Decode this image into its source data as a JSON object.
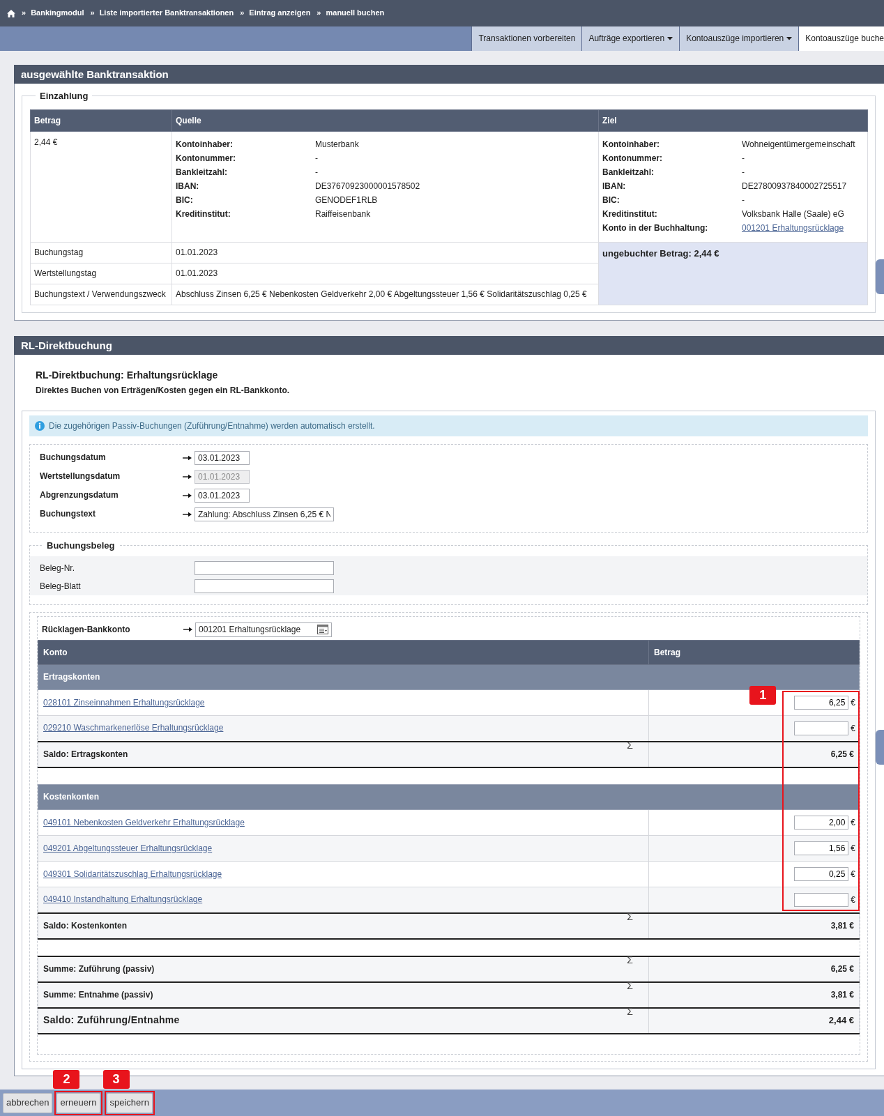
{
  "breadcrumb": {
    "separator": "»",
    "items": [
      "Bankingmodul",
      "Liste importierter Banktransaktionen",
      "Eintrag anzeigen",
      "manuell buchen"
    ]
  },
  "tabs": [
    {
      "label": "Transaktionen vorbereiten",
      "menu": false,
      "selected": false
    },
    {
      "label": "Aufträge exportieren",
      "menu": true,
      "selected": false
    },
    {
      "label": "Kontoauszüge importieren",
      "menu": true,
      "selected": false
    },
    {
      "label": "Kontoauszüge buche",
      "menu": false,
      "selected": true
    }
  ],
  "transaction_panel": {
    "title": "ausgewählte Banktransaktion",
    "legend": "Einzahlung",
    "columns": [
      "Betrag",
      "Quelle",
      "Ziel"
    ],
    "amount": "2,44 €",
    "source": [
      {
        "label": "Kontoinhaber:",
        "value": "Musterbank",
        "kind": "text"
      },
      {
        "label": "Kontonummer:",
        "value": "-",
        "kind": "text"
      },
      {
        "label": "Bankleitzahl:",
        "value": "-",
        "kind": "text"
      },
      {
        "label": "IBAN:",
        "value": "DE37670923000001578502",
        "kind": "text"
      },
      {
        "label": "BIC:",
        "value": "GENODEF1RLB",
        "kind": "text"
      },
      {
        "label": "Kreditinstitut:",
        "value": "Raiffeisenbank",
        "kind": "text"
      }
    ],
    "target": [
      {
        "label": "Kontoinhaber:",
        "value": "Wohneigentümergemeinschaft",
        "kind": "text"
      },
      {
        "label": "Kontonummer:",
        "value": "-",
        "kind": "text"
      },
      {
        "label": "Bankleitzahl:",
        "value": "-",
        "kind": "text"
      },
      {
        "label": "IBAN:",
        "value": "DE27800937840002725517",
        "kind": "text"
      },
      {
        "label": "BIC:",
        "value": "-",
        "kind": "text"
      },
      {
        "label": "Kreditinstitut:",
        "value": "Volksbank Halle (Saale) eG",
        "kind": "text"
      },
      {
        "label": "Konto in der Buchhaltung:",
        "value": "001201 Erhaltungsrücklage",
        "kind": "link"
      }
    ],
    "details": [
      {
        "label": "Buchungstag",
        "value": "01.01.2023"
      },
      {
        "label": "Wertstellungstag",
        "value": "01.01.2023"
      },
      {
        "label": "Buchungstext / Verwendungszweck",
        "value": "Abschluss Zinsen 6,25 € Nebenkosten Geldverkehr 2,00 € Abgeltungssteuer 1,56 € Solidaritätszuschlag 0,25 €"
      }
    ],
    "unbooked": "ungebuchter Betrag: 2,44 €"
  },
  "booking_panel": {
    "title": "RL-Direktbuchung",
    "heading": "RL-Direktbuchung: Erhaltungsrücklage",
    "subheading": "Direktes Buchen von Erträgen/Kosten gegen ein RL-Bankkonto.",
    "info": "Die zugehörigen Passiv-Buchungen (Zuführung/Entnahme) werden automatisch erstellt.",
    "fields": [
      {
        "label": "Buchungsdatum",
        "value": "03.01.2023",
        "kind": "date",
        "disabled": false
      },
      {
        "label": "Wertstellungsdatum",
        "value": "01.01.2023",
        "kind": "date",
        "disabled": true
      },
      {
        "label": "Abgrenzungsdatum",
        "value": "03.01.2023",
        "kind": "date",
        "disabled": false
      },
      {
        "label": "Buchungstext",
        "value": "Zahlung: Abschluss Zinsen 6,25 € N",
        "kind": "text",
        "disabled": false
      }
    ],
    "voucher": {
      "legend": "Buchungsbeleg",
      "fields": [
        {
          "label": "Beleg-Nr."
        },
        {
          "label": "Beleg-Blatt"
        }
      ]
    },
    "reserve_account": {
      "label": "Rücklagen-Bankkonto",
      "value": "001201 Erhaltungsrücklage"
    },
    "accounts_table": {
      "columns": [
        "Konto",
        "Betrag"
      ],
      "annotation": "1",
      "sections": [
        {
          "title": "Ertragskonten",
          "rows": [
            {
              "account": "028101 Zinseinnahmen Erhaltungsrücklage",
              "amount": "6,25",
              "currency": "€"
            },
            {
              "account": "029210 Waschmarkenerlöse Erhaltungsrücklage",
              "currency": "€"
            }
          ],
          "total": {
            "label": "Saldo: Ertragskonten",
            "symbol": "Σ",
            "value": "6,25 €"
          }
        },
        {
          "title": "Kostenkonten",
          "rows": [
            {
              "account": "049101 Nebenkosten Geldverkehr Erhaltungsrücklage",
              "amount": "2,00",
              "currency": "€"
            },
            {
              "account": "049201 Abgeltungssteuer Erhaltungsrücklage",
              "amount": "1,56",
              "currency": "€"
            },
            {
              "account": "049301 Solidaritätszuschlag Erhaltungsrücklage",
              "amount": "0,25",
              "currency": "€"
            },
            {
              "account": "049410 Instandhaltung Erhaltungsrücklage",
              "currency": "€"
            }
          ],
          "total": {
            "label": "Saldo: Kostenkonten",
            "symbol": "Σ",
            "value": "3,81 €"
          }
        }
      ],
      "summary": [
        {
          "label": "Summe: Zuführung (passiv)",
          "symbol": "Σ",
          "value": "6,25 €",
          "emphasis": false
        },
        {
          "label": "Summe: Entnahme (passiv)",
          "symbol": "Σ",
          "value": "3,81 €",
          "emphasis": false
        },
        {
          "label": "Saldo: Zuführung/Entnahme",
          "symbol": "Σ",
          "value": "2,44 €",
          "emphasis": true
        }
      ]
    }
  },
  "buttons": [
    {
      "label": "abbrechen"
    },
    {
      "label": "erneuern",
      "annotation": "2"
    },
    {
      "label": "speichern",
      "annotation": "3"
    }
  ]
}
